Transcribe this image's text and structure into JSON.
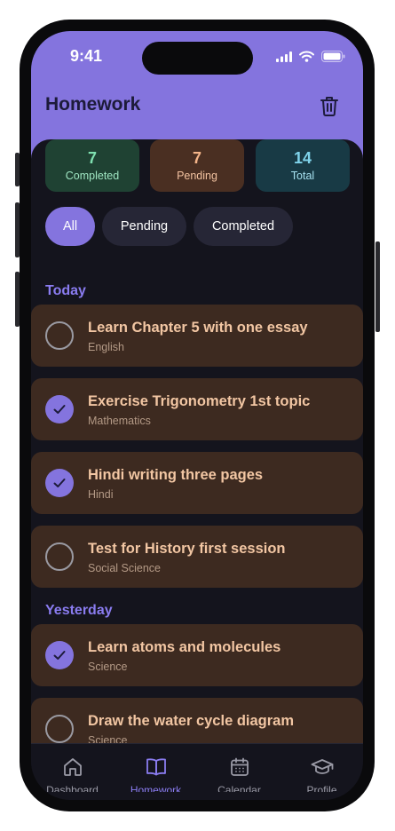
{
  "status": {
    "time": "9:41"
  },
  "header": {
    "title": "Homework"
  },
  "stats": [
    {
      "value": "7",
      "label": "Completed"
    },
    {
      "value": "7",
      "label": "Pending"
    },
    {
      "value": "14",
      "label": "Total"
    }
  ],
  "filters": {
    "all": "All",
    "pending": "Pending",
    "completed": "Completed"
  },
  "sections": {
    "today": "Today",
    "yesterday": "Yesterday"
  },
  "tasks": [
    {
      "title": "Learn Chapter 5 with one essay",
      "subject": "English",
      "done": false
    },
    {
      "title": "Exercise Trigonometry 1st topic",
      "subject": "Mathematics",
      "done": true
    },
    {
      "title": "Hindi writing three pages",
      "subject": "Hindi",
      "done": true
    },
    {
      "title": "Test for History first session",
      "subject": "Social Science",
      "done": false
    },
    {
      "title": "Learn atoms and molecules",
      "subject": "Science",
      "done": true
    },
    {
      "title": "Draw the water cycle diagram",
      "subject": "Science",
      "done": false
    }
  ],
  "nav": {
    "dashboard": "Dashboard",
    "homework": "Homework",
    "calendar": "Calendar",
    "profile": "Profile"
  },
  "colors": {
    "accent": "#8474de",
    "card": "#3d2a20",
    "background": "#14141d"
  }
}
